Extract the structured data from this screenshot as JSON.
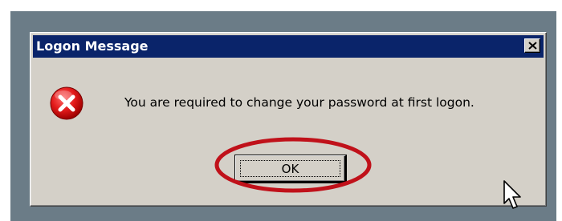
{
  "dialog": {
    "title": "Logon Message",
    "close_glyph": "✕",
    "icon": "error-icon",
    "message": "You are required to change your password at first logon.",
    "ok_label": "OK"
  },
  "colors": {
    "title_bar": "#0a246a",
    "dialog_face": "#d4d0c8",
    "desktop": "#6b7c87",
    "error_red": "#e31b1b",
    "annotation": "#c0111a"
  }
}
